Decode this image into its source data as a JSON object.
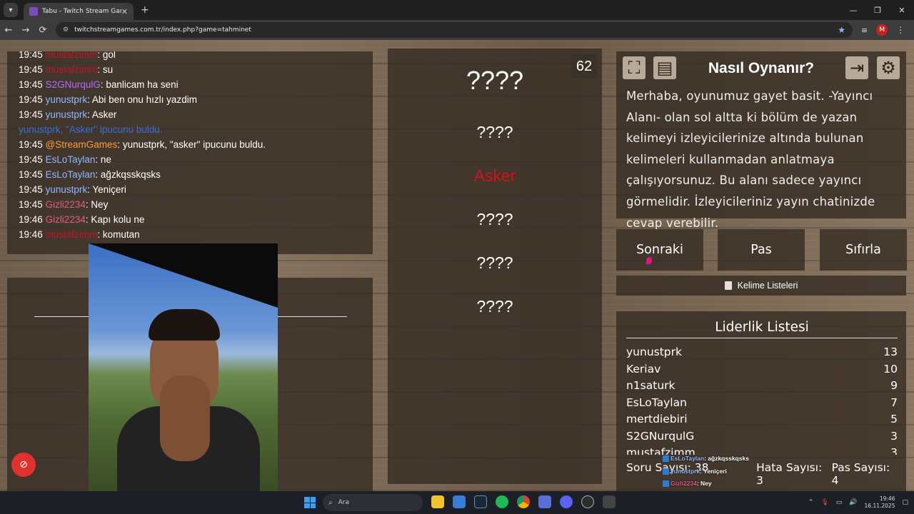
{
  "browser": {
    "tab_title": "Tabu - Twitch Stream Games",
    "url": "twitchstreamgames.com.tr/index.php?game=tahminet",
    "tab_close": "✕",
    "new_tab": "+",
    "back": "←",
    "forward": "→",
    "reload": "⟳",
    "profile_initial": "M",
    "window_controls": [
      "—",
      "❐",
      "✕"
    ]
  },
  "chat": {
    "messages": [
      {
        "time": "19:45",
        "user": "mustafzimm",
        "sep": ": ",
        "text": "gol",
        "color": "#c4122a"
      },
      {
        "time": "19:45",
        "user": "mustafzimm",
        "sep": ": ",
        "text": "su",
        "color": "#c4122a"
      },
      {
        "time": "19:45",
        "user": "S2GNurqulG",
        "sep": ": ",
        "text": "banlicam ha seni",
        "color": "#b36bff"
      },
      {
        "time": "19:45",
        "user": "yunustprk",
        "sep": ": ",
        "text": "Abi ben onu hızlı yazdim",
        "color": "#8fb6ff"
      },
      {
        "time": "19:45",
        "user": "yunustprk",
        "sep": ": ",
        "text": "Asker",
        "color": "#8fb6ff"
      },
      {
        "time": "",
        "user": "yunustprk, \"Asker\" ipucunu buldu.",
        "sep": "",
        "text": "",
        "color": "#3b6fd8"
      },
      {
        "time": "19:45",
        "user": "@StreamGames",
        "sep": ": ",
        "text": "yunustprk, \"asker\" ipucunu buldu.",
        "color": "#ff9a3c"
      },
      {
        "time": "19:45",
        "user": "EsLoTaylan",
        "sep": ": ",
        "text": "ne",
        "color": "#8fb6ff"
      },
      {
        "time": "19:45",
        "user": "EsLoTaylan",
        "sep": ": ",
        "text": "ağzkqsskqsks",
        "color": "#8fb6ff"
      },
      {
        "time": "19:45",
        "user": "yunustprk",
        "sep": ": ",
        "text": "Yeniçeri",
        "color": "#8fb6ff"
      },
      {
        "time": "19:45",
        "user": "Gizli2234",
        "sep": ": ",
        "text": "Ney",
        "color": "#e35b8a"
      },
      {
        "time": "19:46",
        "user": "Gizli2234",
        "sep": ": ",
        "text": "Kapı kolu ne",
        "color": "#e35b8a"
      },
      {
        "time": "19:46",
        "user": "mustafzimm",
        "sep": ": ",
        "text": "komutan",
        "color": "#c4122a"
      }
    ]
  },
  "game": {
    "timer": "62",
    "main_word": "????",
    "taboo_words": [
      {
        "text": "????",
        "found": false
      },
      {
        "text": "Asker",
        "found": true
      },
      {
        "text": "????",
        "found": false
      },
      {
        "text": "????",
        "found": false
      },
      {
        "text": "????",
        "found": false
      }
    ]
  },
  "help": {
    "title": "Nasıl Oynanır?",
    "text": "Merhaba, oyunumuz gayet basit. -Yayıncı Alanı- olan sol altta ki bölüm de yazan kelimeyi izleyicilerinize altında bulunan kelimeleri kullanmadan anlatmaya çalışıyorsunuz. Bu alanı sadece yayıncı görmelidir. İzleyicileriniz yayın chatinizde cevap verebilir.",
    "icons": [
      "fullscreen-icon",
      "notes-icon",
      "logout-icon",
      "settings-icon"
    ]
  },
  "controls": {
    "next": "Sonraki",
    "pass": "Pas",
    "reset": "Sıfırla",
    "word_lists": "Kelime Listeleri"
  },
  "leaderboard": {
    "title": "Liderlik Listesi",
    "rows": [
      {
        "name": "yunustprk",
        "score": "13"
      },
      {
        "name": "Keriav",
        "score": "10"
      },
      {
        "name": "n1saturk",
        "score": "9"
      },
      {
        "name": "EsLoTaylan",
        "score": "7"
      },
      {
        "name": "mertdiebiri",
        "score": "5"
      },
      {
        "name": "S2GNurqulG",
        "score": "3"
      },
      {
        "name": "mustafzimm",
        "score": "3"
      }
    ],
    "question_count": "Soru Sayısı: 38",
    "error_count": "Hata Sayısı: 3",
    "pass_count": "Pas Sayısı: 4"
  },
  "overlay_chat": [
    {
      "user": "EsLoTaylan",
      "text": ": ağzkqsskqsks",
      "color": "#8fb6ff"
    },
    {
      "user": "yunustprk",
      "text": ": Yeniçeri",
      "color": "#8fb6ff"
    },
    {
      "user": "Gizli2234",
      "text": ": Ney",
      "color": "#e35b8a"
    },
    {
      "user": "Gizli2234",
      "text": ": Kapı kolu ne",
      "color": "#e35b8a"
    },
    {
      "user": "mustafzimm",
      "text": ": komutan",
      "color": "#c4122a"
    }
  ],
  "taskbar": {
    "search_placeholder": "Ara",
    "time": "19:46",
    "date": "16.11.2025"
  }
}
